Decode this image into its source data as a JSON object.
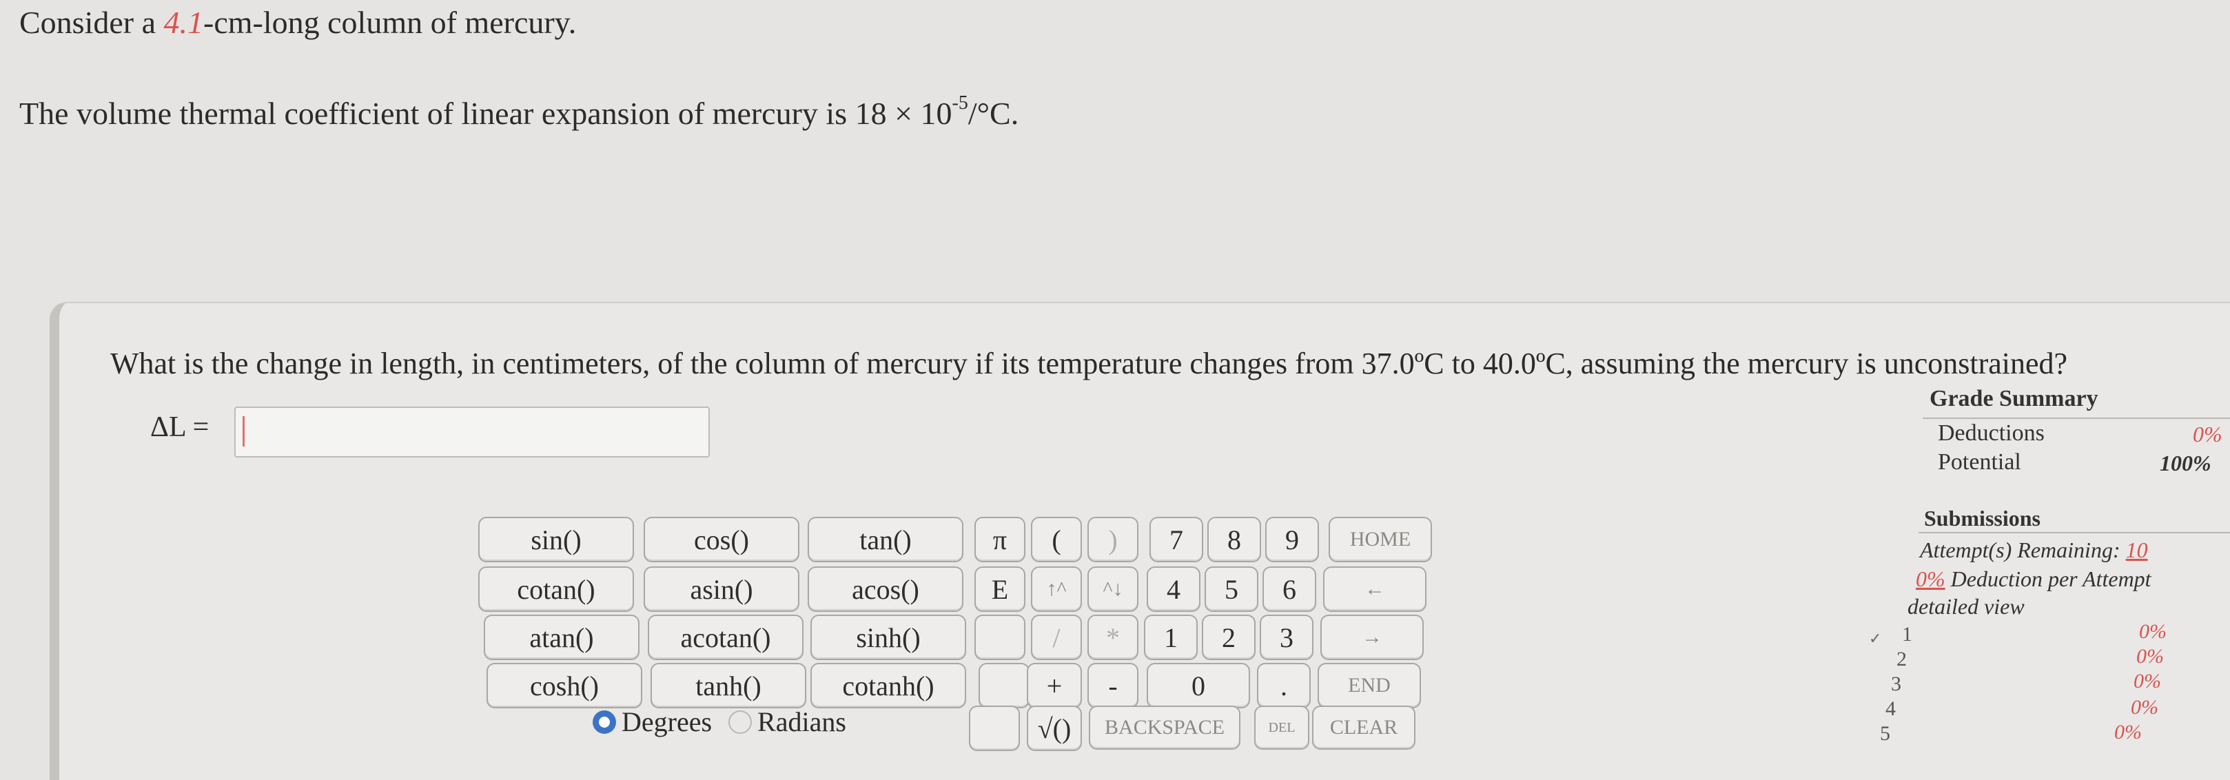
{
  "problem": {
    "line1_pre": "Consider a ",
    "line1_value": "4.1",
    "line1_post": "-cm-long column of mercury.",
    "line2_pre": "The volume thermal coefficient of linear expansion of mercury is 18 × 10",
    "line2_exp": "-5",
    "line2_post": "/°C."
  },
  "question": {
    "text": "What is the change in length, in centimeters, of the column of mercury if its temperature changes from 37.0ºC to 40.0ºC, assuming the mercury is unconstrained?",
    "answer_label": "ΔL = ",
    "answer_value": ""
  },
  "keypad": {
    "functions": [
      [
        "sin()",
        "cos()",
        "tan()"
      ],
      [
        "cotan()",
        "asin()",
        "acos()"
      ],
      [
        "atan()",
        "acotan()",
        "sinh()"
      ],
      [
        "cosh()",
        "tanh()",
        "cotanh()"
      ]
    ],
    "pi": "π",
    "open_paren": "(",
    "close_paren": ")",
    "e": "E",
    "up": "↑^",
    "down": "^↓",
    "divide": "/",
    "multiply": "*",
    "plus": "+",
    "minus": "-",
    "sqrt": "√()",
    "digits": [
      "7",
      "8",
      "9",
      "4",
      "5",
      "6",
      "1",
      "2",
      "3",
      "0"
    ],
    "dot": ".",
    "home": "HOME",
    "left": "←",
    "right": "→",
    "end": "END",
    "backspace": "BACKSPACE",
    "del": "DEL",
    "clear": "CLEAR"
  },
  "angle_mode": {
    "degrees": "Degrees",
    "radians": "Radians",
    "selected": "Degrees"
  },
  "grade_summary": {
    "title": "Grade Summary",
    "deductions_label": "Deductions",
    "deductions_value": "0%",
    "potential_label": "Potential",
    "potential_value": "100%"
  },
  "submissions": {
    "title": "Submissions",
    "attempts_label": "Attempt(s) Remaining: ",
    "attempts_value": "10",
    "deduction_value": "0%",
    "deduction_label": " Deduction per Attempt",
    "detailed_view": "detailed view",
    "rows": [
      {
        "num": "1",
        "pct": "0%"
      },
      {
        "num": "2",
        "pct": "0%"
      },
      {
        "num": "3",
        "pct": "0%"
      },
      {
        "num": "4",
        "pct": "0%"
      },
      {
        "num": "5",
        "pct": "0%"
      }
    ]
  }
}
